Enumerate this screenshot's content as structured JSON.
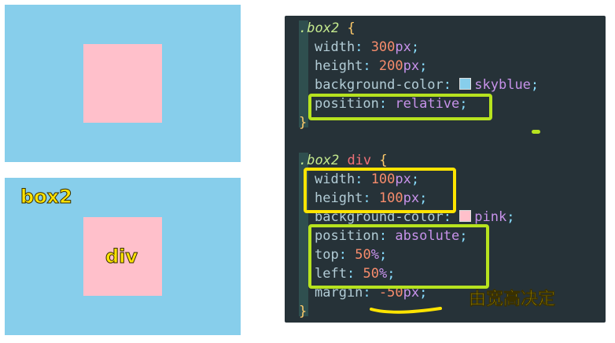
{
  "demo": {
    "box2_label": "box2",
    "div_label": "div"
  },
  "colors": {
    "skyblue": "#87ceeb",
    "pink": "#ffc0cb",
    "highlight_green": "#b7e31f",
    "highlight_yellow": "#ffe400",
    "editor_bg": "#263238"
  },
  "code": {
    "block1": {
      "selector": ".box2",
      "open": "{",
      "width_prop": "width",
      "width_num": "300",
      "width_unit": "px",
      "height_prop": "height",
      "height_num": "200",
      "height_unit": "px",
      "bg_prop": "background-color",
      "bg_value": "skyblue",
      "pos_prop": "position",
      "pos_value": "relative",
      "close": "}"
    },
    "block2": {
      "selector": ".box2",
      "tag": "div",
      "open": "{",
      "width_prop": "width",
      "width_num": "100",
      "width_unit": "px",
      "height_prop": "height",
      "height_num": "100",
      "height_unit": "px",
      "bg_prop": "background-color",
      "bg_value": "pink",
      "pos_prop": "position",
      "pos_value": "absolute",
      "top_prop": "top",
      "top_num": "50",
      "top_unit": "%",
      "left_prop": "left",
      "left_num": "50",
      "left_unit": "%",
      "margin_prop": "margin",
      "margin_num": "-50",
      "margin_unit": "px",
      "close": "}"
    },
    "colon": ":",
    "semicolon": ";"
  },
  "annotation": {
    "note": "由宽高决定"
  }
}
